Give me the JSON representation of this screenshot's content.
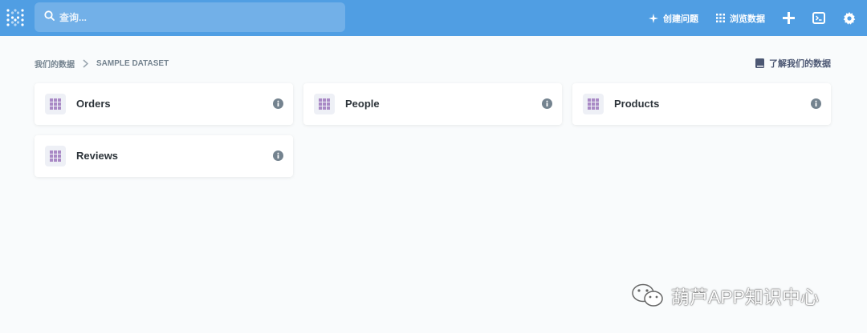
{
  "nav": {
    "search_placeholder": "查询...",
    "create_question": "创建问题",
    "browse_data": "浏览数据"
  },
  "breadcrumb": {
    "root": "我们的数据",
    "current": "SAMPLE DATASET"
  },
  "learn_link": "了解我们的数据",
  "tables": [
    {
      "name": "Orders"
    },
    {
      "name": "People"
    },
    {
      "name": "Products"
    },
    {
      "name": "Reviews"
    }
  ],
  "watermark": "葫芦APP知识中心",
  "colors": {
    "brand": "#509ee3",
    "table_icon": "#a989c5"
  }
}
